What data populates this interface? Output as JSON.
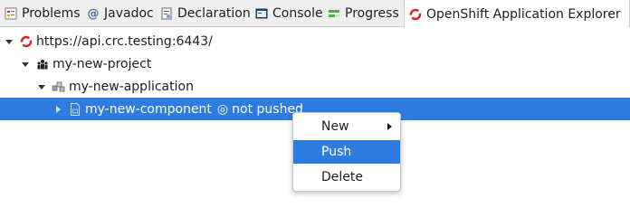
{
  "tabs": [
    {
      "label": "Problems",
      "icon": "problems-icon"
    },
    {
      "label": "Javadoc",
      "icon": "javadoc-icon"
    },
    {
      "label": "Declaration",
      "icon": "declaration-icon"
    },
    {
      "label": "Console",
      "icon": "console-icon"
    },
    {
      "label": "Progress",
      "icon": "progress-icon"
    },
    {
      "label": "OpenShift Application Explorer",
      "icon": "openshift-icon",
      "active": true
    }
  ],
  "tree": {
    "cluster": {
      "label": "https://api.crc.testing:6443/",
      "icon": "openshift-icon",
      "expanded": true
    },
    "project": {
      "label": "my-new-project",
      "icon": "project-icon",
      "expanded": true
    },
    "application": {
      "label": "my-new-application",
      "icon": "application-icon",
      "expanded": true
    },
    "component": {
      "label": "my-new-component",
      "status": "not pushed",
      "icon": "component-icon",
      "expanded": false,
      "selected": true
    }
  },
  "context_menu": {
    "items": [
      {
        "label": "New",
        "has_submenu": true
      },
      {
        "label": "Push",
        "highlighted": true
      },
      {
        "label": "Delete"
      }
    ]
  },
  "colors": {
    "selection": "#2f7ce0",
    "openshift_red": "#db212e",
    "tab_bar": "#efefef"
  }
}
